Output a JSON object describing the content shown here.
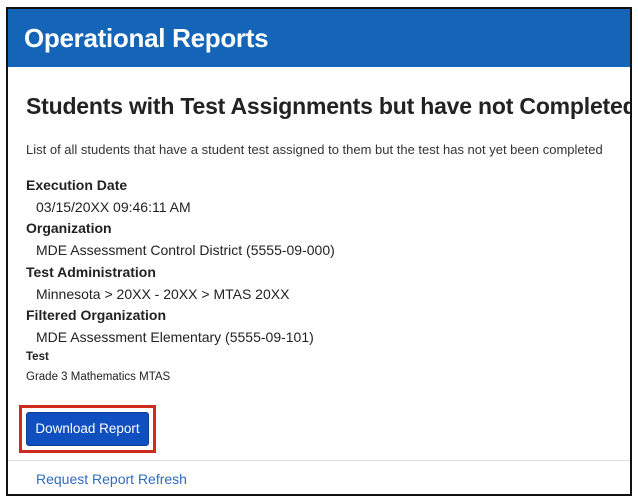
{
  "header": {
    "title": "Operational Reports"
  },
  "report": {
    "title": "Students with Test Assignments but have not Completed",
    "description": "List of all students that have a student test assigned to them but the test has not yet been completed"
  },
  "fields": {
    "execution_date": {
      "label": "Execution Date",
      "value": "03/15/20XX 09:46:11 AM"
    },
    "organization": {
      "label": "Organization",
      "value": "MDE Assessment Control District (5555-09-000)"
    },
    "test_administration": {
      "label": "Test Administration",
      "value": "Minnesota > 20XX - 20XX > MTAS 20XX"
    },
    "filtered_organization": {
      "label": "Filtered Organization",
      "value": "MDE Assessment Elementary (5555-09-101)"
    },
    "test": {
      "label": "Test",
      "value": "Grade 3 Mathematics MTAS"
    }
  },
  "actions": {
    "download_label": "Download Report",
    "refresh_label": "Request Report Refresh"
  },
  "colors": {
    "header_bg": "#1465b8",
    "button_bg": "#0f4fbf",
    "highlight_border": "#d02a1f",
    "link": "#2f6cc0"
  }
}
